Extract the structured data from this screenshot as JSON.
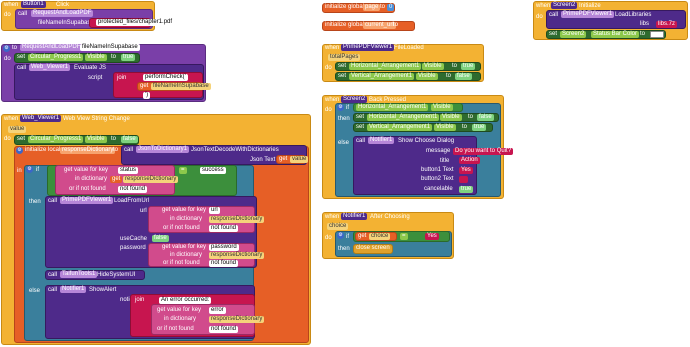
{
  "b1": {
    "when": "when",
    "button": "Button1",
    "event": "Click",
    "do": "do",
    "call": "call",
    "proc": "RequestAndLoadPDF",
    "param": "fileNameInSupabase",
    "value": "protected_files/chapter1.pdf"
  },
  "req": {
    "to": "to",
    "name": "RequestAndLoadPDF",
    "param": "fileNameInSupabase",
    "do": "do",
    "set": "set",
    "progress": "Circular_Progress1",
    "visible": "Visible",
    "to2": "to",
    "true": "true",
    "call": "call",
    "viewer": "Web_Viewer1",
    "evaluate": "Evaluate JS",
    "script": "script",
    "join": "join",
    "performCheck": "performCheck('",
    "get": "get",
    "arg": "fileNameInSupabase",
    "close": "')"
  },
  "wv": {
    "when": "when",
    "comp": "Web_Viewer1",
    "event": "Web View String Change",
    "value": "value",
    "do": "do",
    "set": "set",
    "progress": "Circular_Progress1",
    "visible": "Visible",
    "to": "to",
    "false": "false",
    "init_local": "initialize local",
    "local_name": "responseDictionary",
    "to2": "to",
    "call": "call",
    "json": "JsonToDictionary1",
    "decode": "JsonTextDecodeWithDictionaries",
    "json_text": "Json Text",
    "get": "get",
    "get_value": "value",
    "in": "in",
    "if": "if",
    "then": "then",
    "else": "else",
    "cond": {
      "getval": "get value for key",
      "key": "status",
      "eq": "=",
      "success": "success",
      "in_dict": "in dictionary",
      "get": "get",
      "dict": "responseDictionary",
      "not_found": "or if not found",
      "nf": "not found"
    },
    "then_call": "call",
    "pdf": "PrimePDFViewer1",
    "load": "LoadFromUrl",
    "url": "url",
    "url_key": "url",
    "use_cache": "useCache",
    "cache_val": "false",
    "password": "password",
    "pw_key": "password",
    "tafun": "TaifunTools1",
    "hide": "HideSystemUI",
    "notifier": "Notifier1",
    "show_alert": "ShowAlert",
    "notice": "notice",
    "join": "join",
    "err_text": "An error occurred: ",
    "err_key": "error"
  },
  "globals": {
    "init_global": "initialize global",
    "page": "page",
    "page_to": "to",
    "page_val": "0",
    "current_url": "current_url",
    "cu_to": "to",
    "cu_val": " "
  },
  "fl": {
    "when": "when",
    "comp": "PrimePDFViewer1",
    "event": "FileLoaded",
    "param": "totalPages",
    "do": "do",
    "set": "set",
    "h": "Horizontal_Arrangement1",
    "v": "Vertical_Arrangement1",
    "visible": "Visible",
    "to": "to",
    "true": "true",
    "false": "false"
  },
  "bp": {
    "when": "when",
    "comp": "Screen2",
    "event": "Back Pressed",
    "do": "do",
    "if": "if",
    "then": "then",
    "else": "else",
    "h": "Horizontal_Arrangement1",
    "v": "Vertical_Arrangement1",
    "visible": "Visible",
    "set": "set",
    "to": "to",
    "true": "true",
    "false": "false",
    "call": "call",
    "notifier": "Notifier1",
    "dialog": "Show Choose Dialog",
    "message": "message",
    "msg": "Do you want to Quit?",
    "title": "title",
    "title_val": "Action",
    "b1": "button1 Text",
    "b1v": "Yes",
    "b2": "button2 Text",
    "b2v": "",
    "cancel": "cancelable",
    "cancel_v": "true"
  },
  "ac": {
    "when": "when",
    "comp": "Notifier1",
    "event": "After Choosing",
    "param": "choice",
    "do": "do",
    "if": "if",
    "then": "then",
    "get": "get",
    "choice": "choice",
    "eq": "=",
    "yes": "Yes",
    "close": "close screen"
  },
  "init": {
    "when": "when",
    "comp": "Screen2",
    "event": "Initialize",
    "do": "do",
    "call": "call",
    "pdf": "PrimePDFViewer1",
    "load": "LoadLibraries",
    "libs": "libs",
    "libs_val": "libs.7z",
    "set": "set",
    "screen": "Screen2",
    "status": "Status Bar Color",
    "to": "to"
  },
  "colors": {
    "event": "#f3b233",
    "procedure": "#7a3fa8",
    "component": "#4e2a8a",
    "setter": "#2e6b2e",
    "variable": "#e65f26",
    "text": "#c7154f",
    "logic": "#3c8f3c",
    "status_bar": "#ffffff"
  }
}
